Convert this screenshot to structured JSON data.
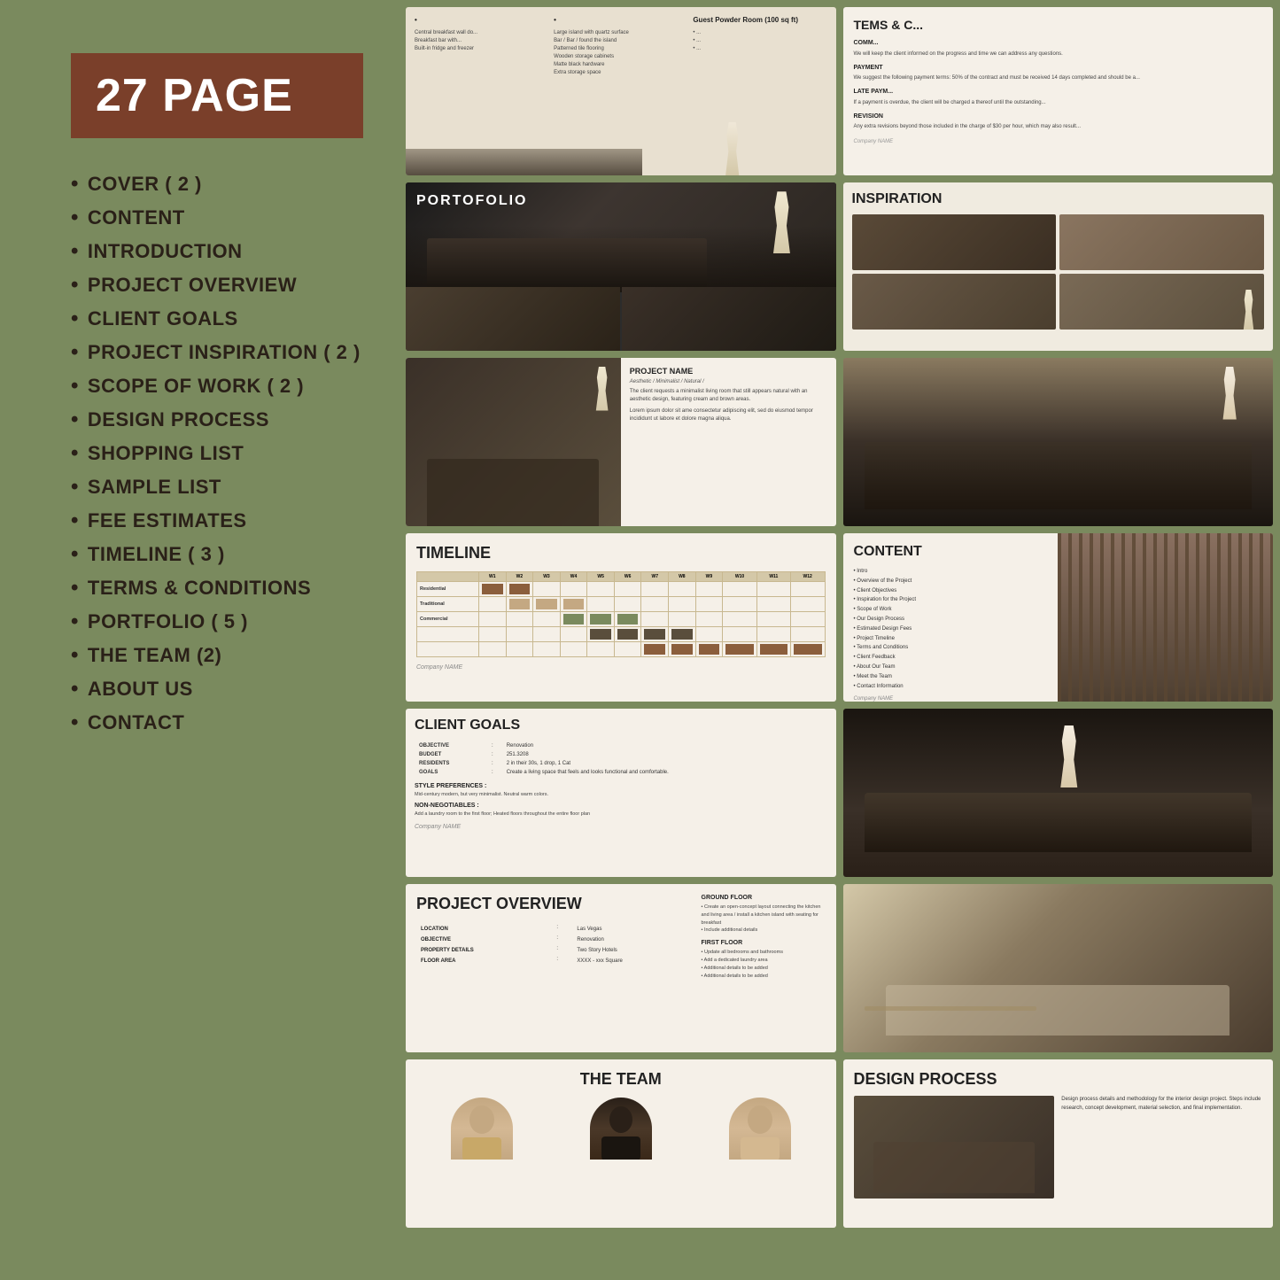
{
  "badge": {
    "text": "27 PAGE"
  },
  "menu": {
    "items": [
      {
        "label": "COVER ( 2 )"
      },
      {
        "label": "CONTENT"
      },
      {
        "label": "INTRODUCTION"
      },
      {
        "label": "PROJECT OVERVIEW"
      },
      {
        "label": "CLIENT GOALS"
      },
      {
        "label": "PROJECT INSPIRATION ( 2 )"
      },
      {
        "label": "SCOPE OF WORK ( 2 )"
      },
      {
        "label": "DESIGN PROCESS"
      },
      {
        "label": "SHOPPING LIST"
      },
      {
        "label": "SAMPLE LIST"
      },
      {
        "label": "FEE ESTIMATES"
      },
      {
        "label": "TIMELINE ( 3 )"
      },
      {
        "label": "TERMS & CONDITIONS"
      },
      {
        "label": "PORTFOLIO ( 5 )"
      },
      {
        "label": "THE TEAM (2)"
      },
      {
        "label": "ABOUT US"
      },
      {
        "label": "CONTACT"
      }
    ]
  },
  "slides": {
    "portfolio_label": "PORTOFOLIO",
    "inspiration_title": "INSPIRATION",
    "timeline_title": "TIMELINE",
    "content_title": "CONTENT",
    "client_goals_title": "CLIENT GOALS",
    "project_overview_title": "PROJECT OVERVIEW",
    "the_team_title": "THE TEAM",
    "design_process_title": "DESIGN PROCESS",
    "terms_title": "TEMS & C...",
    "project_name_label": "PROJECT NAME",
    "project_aesthetic": "Aesthetic / Minimalist / Natural /",
    "project_desc": "The client requests a minimalist living room that still appears natural with an aesthetic design, featuring cream and brown areas.",
    "project_desc2": "Lorem ipsum dolor sit ame consectetur adipiscing elit, sed do eiusmod tempor incididunt ut labore et dolore magna aliqua.",
    "company_name": "Company NAME",
    "timeline_rows": [
      {
        "label": "Residential",
        "cols": [
          1,
          1,
          0,
          0,
          0,
          0,
          0,
          0,
          0,
          0,
          0,
          0
        ]
      },
      {
        "label": "Traditional",
        "cols": [
          0,
          1,
          1,
          1,
          0,
          0,
          0,
          0,
          0,
          0,
          0,
          0
        ]
      },
      {
        "label": "Commercial",
        "cols": [
          0,
          0,
          0,
          1,
          1,
          1,
          0,
          0,
          0,
          0,
          0,
          0
        ]
      }
    ],
    "timeline_weeks": [
      "Week 1",
      "Week 2",
      "Week 3",
      "Week 4",
      "Week 5",
      "Week 6",
      "Week 7",
      "Week 8",
      "Week 9",
      "Week 10",
      "Week 11",
      "Week 12"
    ],
    "content_list": [
      "Intro",
      "Overview of the Project",
      "Client Objectives",
      "Inspiration for the Project",
      "Scope of Work",
      "Our Design Process",
      "Estimated Design Fees",
      "Project Timeline",
      "Terms and Conditions",
      "Client Feedback",
      "About Our Team",
      "Meet the Team",
      "Contact Information"
    ],
    "client_goals": {
      "objective": "Renovation",
      "budget": "251.3208",
      "residents": "1 drop, 1 Cat",
      "goals": "Create a living space that feels and looks functional and comfortable.",
      "style_pref": "Mid-century modern, but very minimalist. Neutral warm colors.",
      "non_neg": "Add a laundry room to the first floor; Heated floors throughout the entire floor plan"
    },
    "project_overview": {
      "location": "Las Vegas",
      "objective": "Renovation",
      "property_details": "Two Story Hotels",
      "floor_area": "XXXX - xxx Square",
      "ground_floor_items": [
        "Create an open-concept layout connecting the kitchen and living area / install a kitchen island with seating for breakfast",
        "Include additional details"
      ],
      "first_floor_items": [
        "Update all bedrooms and bathrooms",
        "Add a dedicated laundry area",
        "Additional details to be added",
        "Additional details to be added"
      ]
    },
    "terms_sections": [
      {
        "label": "COMM...",
        "text": "We will keep the client informed on the progress and time we can address any questions."
      },
      {
        "label": "PAYMENT",
        "text": "We suggest the following payment terms: 50% of the contract and must be received 14 days completed and should..."
      },
      {
        "label": "LATE PAYM...",
        "text": "If a payment is overdue, the client will be charged a thereof until the outstanding..."
      },
      {
        "label": "REVISION",
        "text": "Any extra revisions beyond those included in the charge of $30 per hour, which may also result..."
      }
    ]
  }
}
